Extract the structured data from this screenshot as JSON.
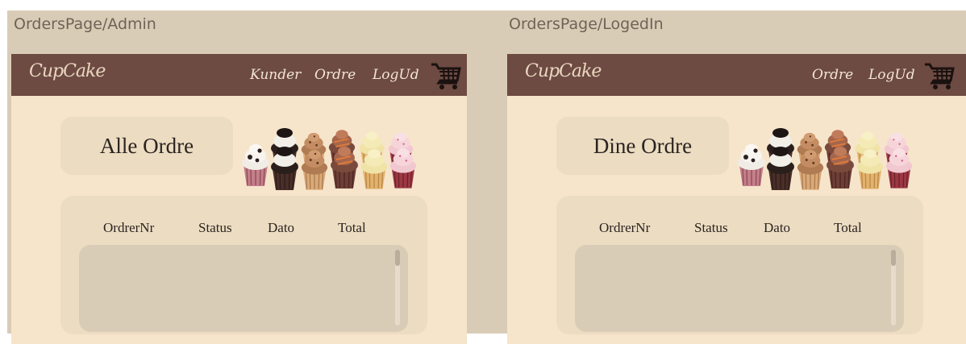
{
  "frames": [
    {
      "title": "OrdersPage/Admin",
      "nav": {
        "logo": "CupCake",
        "links": [
          "Kunder",
          "Ordre",
          "LogUd"
        ],
        "cart_icon": "shopping-cart-icon"
      },
      "heading": "Alle Ordre",
      "columns": [
        "OrdrerNr",
        "Status",
        "Dato",
        "Total"
      ]
    },
    {
      "title": "OrdersPage/LogedIn",
      "nav": {
        "logo": "CupCake",
        "links": [
          "Ordre",
          "LogUd"
        ],
        "cart_icon": "shopping-cart-icon"
      },
      "heading": "Dine Ordre",
      "columns": [
        "OrdrerNr",
        "Status",
        "Dato",
        "Total"
      ]
    }
  ],
  "colors": {
    "board": "#d9ccb6",
    "page_bg": "#f6e5cb",
    "navbar": "#6d4a42",
    "panel": "#ecdcc2",
    "list": "#d9ccb6"
  }
}
